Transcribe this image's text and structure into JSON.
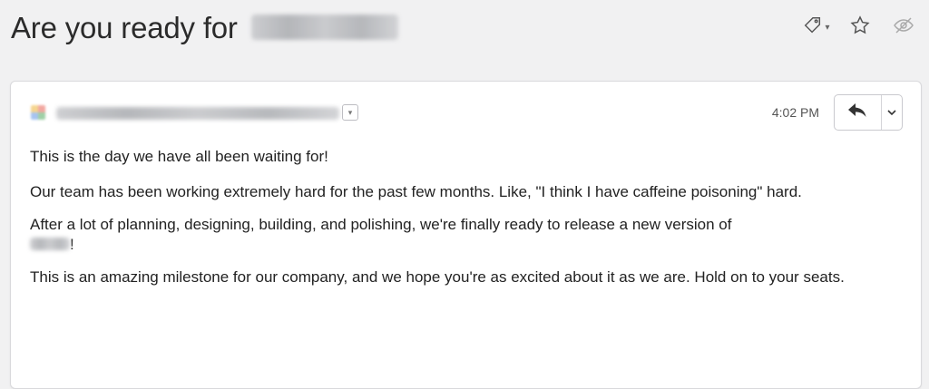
{
  "subject": {
    "text": "Are you ready for",
    "redacted_icon": "blurred-text"
  },
  "subject_actions": {
    "tag_icon": "tag-icon",
    "star_icon": "star-icon",
    "hide_icon": "eye-slash-icon"
  },
  "message": {
    "sender_icon": "blurred-sender",
    "time": "4:02 PM",
    "reply_icon": "reply-arrow-icon",
    "more_icon": "chevron-down-icon",
    "paragraphs": [
      "This is the day we have all been waiting for!",
      "Our team has been working extremely hard for the past few months. Like, \"I think I have caffeine poisoning\" hard.",
      "After a lot of planning, designing, building, and polishing, we're finally ready to release a new version of",
      "This is an amazing milestone for our company, and we hope you're as excited about it as we are. Hold on to your seats."
    ],
    "paragraph3_tail": "!"
  },
  "colors": {
    "background": "#f1f1f2",
    "card": "#ffffff",
    "text": "#222222",
    "muted": "#555555"
  }
}
